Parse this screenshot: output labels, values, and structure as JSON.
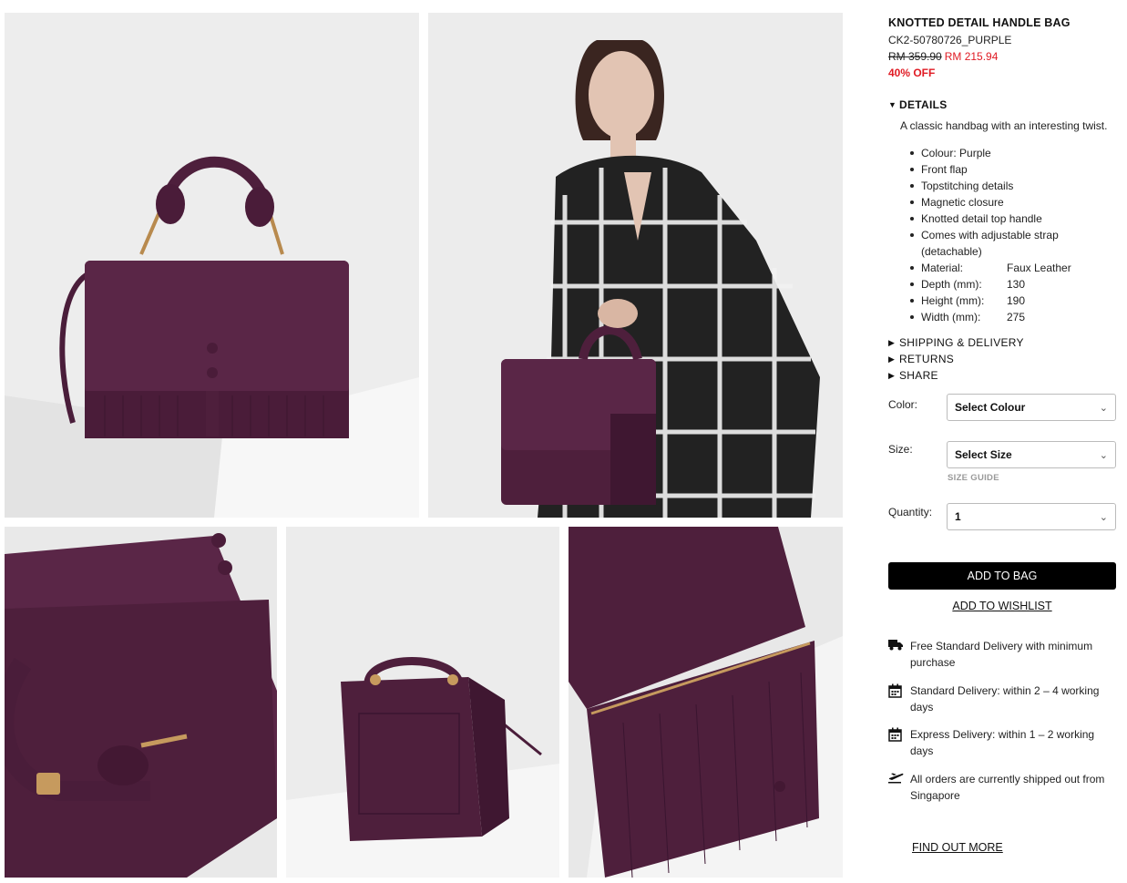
{
  "gallery": {
    "images": [
      {
        "alt": "Purple knotted handle bag on white block"
      },
      {
        "alt": "Model in plaid blazer holding purple bag"
      },
      {
        "alt": "Close-up of bag handle and flap"
      },
      {
        "alt": "Back view of bag"
      },
      {
        "alt": "Open bag interior with zip pocket"
      }
    ],
    "accent_purple": "#4e1f3c"
  },
  "product": {
    "title": "KNOTTED DETAIL HANDLE BAG",
    "sku": "CK2-50780726_PURPLE",
    "old_price": "RM 359.90",
    "new_price": "RM 215.94",
    "discount": "40% OFF",
    "price_color": "#e01b24"
  },
  "details": {
    "heading": "DETAILS",
    "description": "A classic handbag with an interesting twist.",
    "features": [
      "Colour: Purple",
      "Front flap",
      "Topstitching details",
      "Magnetic closure",
      "Knotted detail top handle",
      "Comes with adjustable strap (detachable)"
    ],
    "specs": [
      {
        "label": "Material:",
        "value": "Faux Leather"
      },
      {
        "label": "Depth (mm):",
        "value": "130"
      },
      {
        "label": "Height (mm):",
        "value": "190"
      },
      {
        "label": "Width (mm):",
        "value": "275"
      }
    ]
  },
  "sections": {
    "shipping": "SHIPPING & DELIVERY",
    "returns": "RETURNS",
    "share": "SHARE"
  },
  "options": {
    "color_label": "Color:",
    "color_value": "Select Colour",
    "size_label": "Size:",
    "size_value": "Select Size",
    "size_guide": "SIZE GUIDE",
    "quantity_label": "Quantity:",
    "quantity_value": "1"
  },
  "actions": {
    "add_to_bag": "ADD TO BAG",
    "add_to_wishlist": "ADD TO WISHLIST"
  },
  "delivery_info": [
    {
      "icon": "truck-icon",
      "text": "Free Standard Delivery with minimum purchase"
    },
    {
      "icon": "calendar-icon",
      "text": "Standard Delivery: within 2 – 4 working days"
    },
    {
      "icon": "calendar-icon",
      "text": "Express Delivery: within 1 – 2 working days"
    },
    {
      "icon": "plane-icon",
      "text": "All orders are currently shipped out from Singapore"
    }
  ],
  "find_out_more": "FIND OUT MORE"
}
